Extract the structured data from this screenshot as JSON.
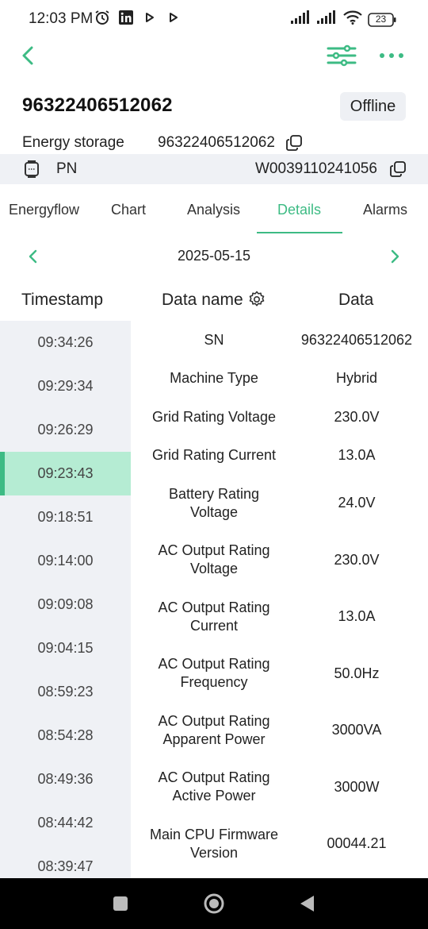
{
  "status_bar": {
    "time": "12:03 PM",
    "battery": "23",
    "icons": [
      "alarm-clock-icon",
      "linkedin-icon",
      "play-icon",
      "play-icon",
      "signal-icon",
      "signal-icon",
      "wifi-icon",
      "battery-icon"
    ]
  },
  "header": {
    "icons": [
      "back-chevron-icon",
      "filter-sliders-icon",
      "more-dots-icon"
    ]
  },
  "device": {
    "title": "96322406512062",
    "status": "Offline",
    "type_label": "Energy storage",
    "type_value": "96322406512062",
    "pn_label": "PN",
    "pn_value": "W0039110241056"
  },
  "tabs": [
    {
      "label": "Energyflow",
      "active": false
    },
    {
      "label": "Chart",
      "active": false
    },
    {
      "label": "Analysis",
      "active": false
    },
    {
      "label": "Details",
      "active": true
    },
    {
      "label": "Alarms",
      "active": false
    }
  ],
  "date_nav": {
    "date": "2025-05-15"
  },
  "table_header": {
    "timestamp": "Timestamp",
    "data_name": "Data name",
    "data": "Data"
  },
  "timestamps": [
    "09:34:26",
    "09:29:34",
    "09:26:29",
    "09:23:43",
    "09:18:51",
    "09:14:00",
    "09:09:08",
    "09:04:15",
    "08:59:23",
    "08:54:28",
    "08:49:36",
    "08:44:42",
    "08:39:47"
  ],
  "selected_timestamp": "09:23:43",
  "rows": [
    {
      "name": "SN",
      "value": "96322406512062"
    },
    {
      "name": "Machine Type",
      "value": "Hybrid"
    },
    {
      "name": "Grid Rating Voltage",
      "value": "230.0V"
    },
    {
      "name": "Grid Rating Current",
      "value": "13.0A"
    },
    {
      "name": "Battery Rating Voltage",
      "value": "24.0V"
    },
    {
      "name": "AC Output Rating Voltage",
      "value": "230.0V"
    },
    {
      "name": "AC Output Rating Current",
      "value": "13.0A"
    },
    {
      "name": "AC Output Rating Frequency",
      "value": "50.0Hz"
    },
    {
      "name": "AC Output Rating Apparent Power",
      "value": "3000VA"
    },
    {
      "name": "AC Output Rating Active Power",
      "value": "3000W"
    },
    {
      "name": "Main CPU Firmware Version",
      "value": "00044.21"
    }
  ],
  "colors": {
    "accent": "#3dbb84",
    "selected_bg": "#b5ecd3",
    "panel_bg": "#eff1f5"
  }
}
